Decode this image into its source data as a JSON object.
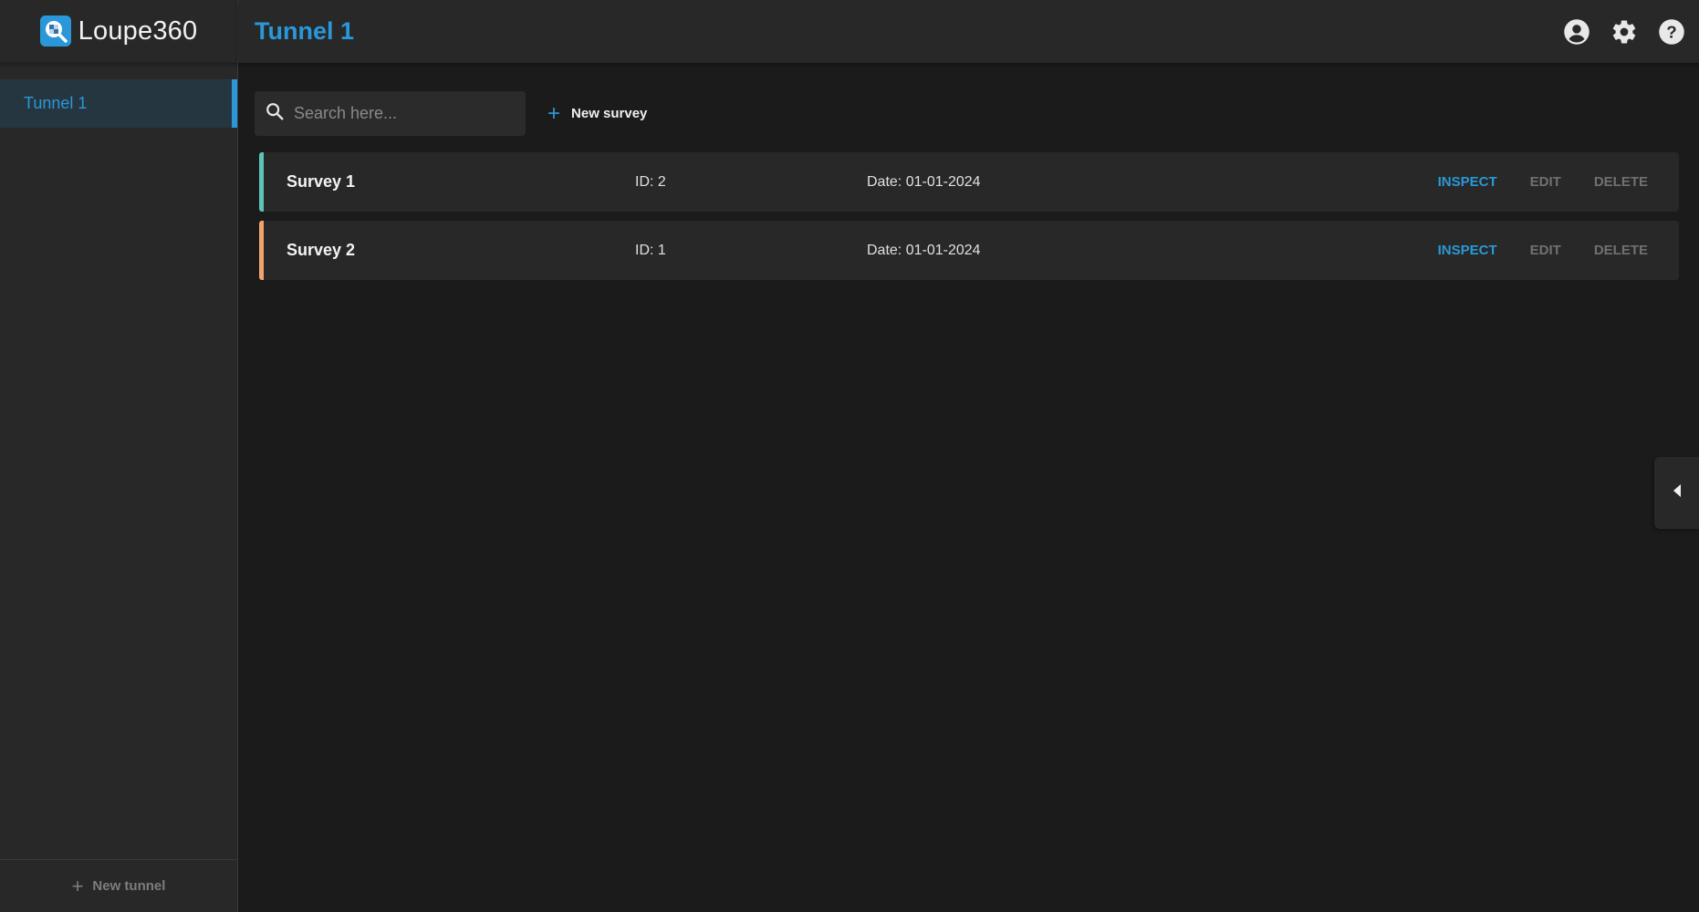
{
  "app": {
    "name": "Loupe360"
  },
  "sidebar": {
    "items": [
      {
        "label": "Tunnel 1",
        "active": true
      }
    ],
    "new_tunnel_label": "New tunnel"
  },
  "header": {
    "title": "Tunnel 1",
    "icons": [
      "account-icon",
      "settings-icon",
      "help-icon"
    ]
  },
  "toolbar": {
    "search_placeholder": "Search here...",
    "search_value": "",
    "new_survey_label": "New survey"
  },
  "surveys": [
    {
      "name": "Survey 1",
      "id": "ID: 2",
      "date": "Date: 01-01-2024",
      "accent": "#5ec4b6",
      "inspect": "INSPECT",
      "edit": "EDIT",
      "delete": "DELETE"
    },
    {
      "name": "Survey 2",
      "id": "ID: 1",
      "date": "Date: 01-01-2024",
      "accent": "#f0a56e",
      "inspect": "INSPECT",
      "edit": "EDIT",
      "delete": "DELETE"
    }
  ],
  "colors": {
    "accent": "#2a98d8",
    "background": "#1b1b1b",
    "panel": "#282828"
  }
}
